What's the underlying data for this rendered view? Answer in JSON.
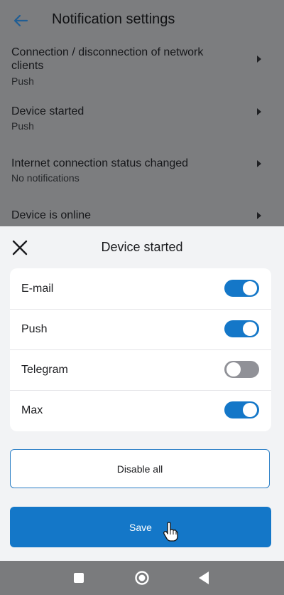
{
  "header": {
    "title": "Notification settings",
    "back_icon": "arrow-left-icon"
  },
  "settings_list": [
    {
      "title": "Connection / disconnection of network clients",
      "value": "Push"
    },
    {
      "title": "Device started",
      "value": "Push"
    },
    {
      "title": "Internet connection status changed",
      "value": "No notifications"
    },
    {
      "title": "Device is online",
      "value": ""
    }
  ],
  "sheet": {
    "title": "Device started",
    "close_icon": "close-icon",
    "options": [
      {
        "label": "E-mail",
        "enabled": true
      },
      {
        "label": "Push",
        "enabled": true
      },
      {
        "label": "Telegram",
        "enabled": false
      },
      {
        "label": "Max",
        "enabled": true
      }
    ],
    "disable_all_label": "Disable all",
    "save_label": "Save"
  },
  "colors": {
    "accent": "#1477c8",
    "toggle_off": "#909197",
    "sheet_bg": "#f2f3f5",
    "overlay": "#7a7b7d"
  },
  "navbar": {
    "recent_icon": "square-icon",
    "home_icon": "circle-icon",
    "back_icon": "triangle-back-icon"
  }
}
